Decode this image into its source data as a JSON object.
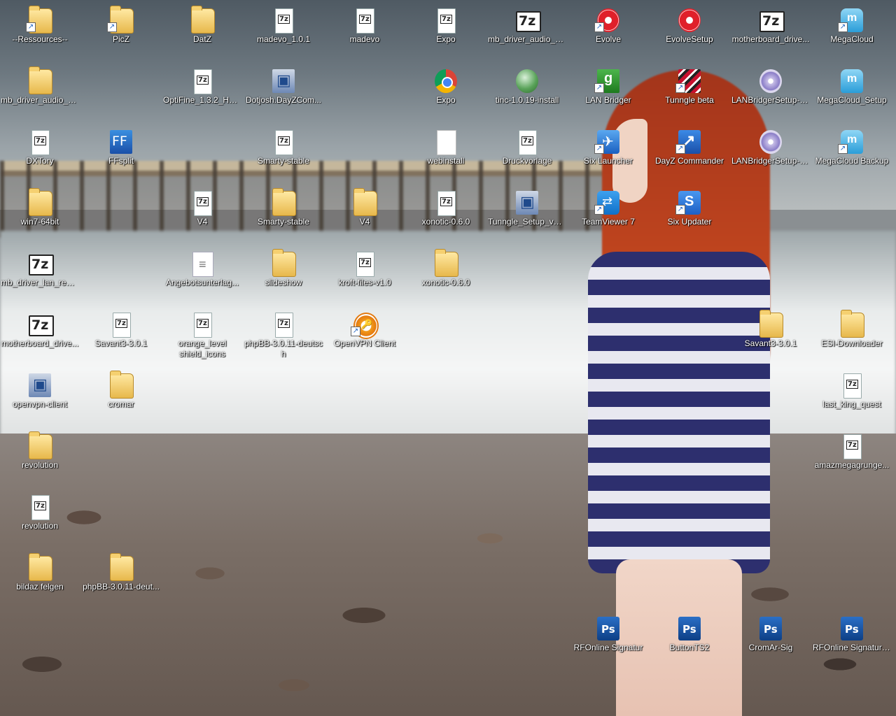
{
  "desktop": {
    "icons": [
      {
        "label": "--Ressources--",
        "icon": "folder-icon",
        "shortcut": true
      },
      {
        "label": "PicZ",
        "icon": "folder-icon",
        "shortcut": true
      },
      {
        "label": "DatZ",
        "icon": "folder-icon",
        "shortcut": false
      },
      {
        "label": "madevo_1.0.1",
        "icon": "archive-7z-icon",
        "shortcut": false
      },
      {
        "label": "madevo",
        "icon": "archive-7z-icon",
        "shortcut": false
      },
      {
        "label": "Expo",
        "icon": "archive-7z-icon",
        "shortcut": false
      },
      {
        "label": "mb_driver_audio_re...",
        "icon": "sevenzip-icon",
        "shortcut": false
      },
      {
        "label": "Evolve",
        "icon": "evolve-icon",
        "shortcut": true
      },
      {
        "label": "EvolveSetup",
        "icon": "evolve-icon",
        "shortcut": false
      },
      {
        "label": "motherboard_drive...",
        "icon": "sevenzip-icon",
        "shortcut": false
      },
      {
        "label": "MegaCloud",
        "icon": "megacloud-icon",
        "shortcut": true
      },
      {
        "label": "mb_driver_audio_re...",
        "icon": "folder-icon",
        "shortcut": false
      },
      {
        "label": "OptiFine_1.3.2_HD...",
        "icon": "archive-7z-icon",
        "shortcut": false
      },
      {
        "label": "Dotjosh.DayZCom...",
        "icon": "installer-icon",
        "shortcut": false
      },
      {
        "label": "Expo",
        "icon": "chrome-icon",
        "shortcut": false
      },
      {
        "label": "tinc-1.0.19-install",
        "icon": "tinc-icon",
        "shortcut": false
      },
      {
        "label": "LAN Bridger",
        "icon": "lanbridger-icon",
        "shortcut": true
      },
      {
        "label": "Tunngle beta",
        "icon": "tunngle-icon",
        "shortcut": true
      },
      {
        "label": "LANBridgerSetup-0...",
        "icon": "disc-setup-icon",
        "shortcut": false
      },
      {
        "label": "MegaCloud_Setup",
        "icon": "megacloud-icon",
        "shortcut": false
      },
      {
        "label": "DXTory",
        "icon": "archive-7z-icon",
        "shortcut": false
      },
      {
        "label": "FFsplit",
        "icon": "ffsplit-icon",
        "shortcut": false
      },
      {
        "label": "Smarty-stable",
        "icon": "archive-7z-icon",
        "shortcut": false
      },
      {
        "label": "webinstall",
        "icon": "file-icon",
        "shortcut": false
      },
      {
        "label": "Druckvorlage",
        "icon": "archive-7z-icon",
        "shortcut": false
      },
      {
        "label": "Six Launcher",
        "icon": "rocket-icon",
        "shortcut": true
      },
      {
        "label": "DayZ Commander",
        "icon": "dayz-commander-icon",
        "shortcut": true
      },
      {
        "label": "LANBridgerSetup-0...",
        "icon": "disc-setup-icon",
        "shortcut": false
      },
      {
        "label": "MegaCloud Backup",
        "icon": "megacloud-icon",
        "shortcut": true
      },
      {
        "label": "win7-64bit",
        "icon": "folder-icon",
        "shortcut": false
      },
      {
        "label": "V4",
        "icon": "archive-7z-icon",
        "shortcut": false
      },
      {
        "label": "Smarty-stable",
        "icon": "folder-icon",
        "shortcut": false
      },
      {
        "label": "V4",
        "icon": "folder-icon",
        "shortcut": false
      },
      {
        "label": "xonotic-0.6.0",
        "icon": "archive-7z-icon",
        "shortcut": false
      },
      {
        "label": "Tunngle_Setup_v4....",
        "icon": "installer-icon",
        "shortcut": false
      },
      {
        "label": "TeamViewer 7",
        "icon": "teamviewer-icon",
        "shortcut": true
      },
      {
        "label": "Six Updater",
        "icon": "six-updater-icon",
        "shortcut": true
      },
      {
        "label": "mb_driver_lan_real...",
        "icon": "sevenzip-icon",
        "shortcut": false
      },
      {
        "label": "Angebotsunterlag...",
        "icon": "document-icon",
        "shortcut": false
      },
      {
        "label": "slideshow",
        "icon": "folder-icon",
        "shortcut": false
      },
      {
        "label": "kroft-files-v1.0",
        "icon": "archive-7z-icon",
        "shortcut": false
      },
      {
        "label": "xonotic-0.6.0",
        "icon": "folder-icon",
        "shortcut": false
      },
      {
        "label": "motherboard_drive...",
        "icon": "sevenzip-icon",
        "shortcut": false
      },
      {
        "label": "Savant3-3.0.1",
        "icon": "archive-7z-icon",
        "shortcut": false
      },
      {
        "label": "orange_level shield_icons",
        "icon": "archive-7z-icon",
        "shortcut": false
      },
      {
        "label": "phpBB-3.0.11-deutsch",
        "icon": "archive-7z-icon",
        "shortcut": false
      },
      {
        "label": "OpenVPN Client",
        "icon": "openvpn-icon",
        "shortcut": true
      },
      {
        "label": "Savant3-3.0.1",
        "icon": "folder-icon",
        "shortcut": false
      },
      {
        "label": "ESI-Downloader",
        "icon": "folder-icon",
        "shortcut": false
      },
      {
        "label": "openvpn-client",
        "icon": "installer-icon",
        "shortcut": false
      },
      {
        "label": "cromar",
        "icon": "folder-icon",
        "shortcut": false
      },
      {
        "label": "last_king_quest",
        "icon": "archive-7z-icon",
        "shortcut": false
      },
      {
        "label": "revolution",
        "icon": "folder-icon",
        "shortcut": false
      },
      {
        "label": "amazmegagrunge...",
        "icon": "archive-7z-icon",
        "shortcut": false
      },
      {
        "label": "revolution",
        "icon": "archive-7z-icon",
        "shortcut": false
      },
      {
        "label": "bildaz felgen",
        "icon": "folder-icon",
        "shortcut": false
      },
      {
        "label": "phpBB-3.0.11-deut...",
        "icon": "folder-icon",
        "shortcut": false
      },
      {
        "label": "RFOnline Signatur",
        "icon": "photoshop-psd-icon",
        "shortcut": false
      },
      {
        "label": "ButtonTS2",
        "icon": "photoshop-psd-icon",
        "shortcut": false
      },
      {
        "label": "CromAr-Sig",
        "icon": "photoshop-psd-icon",
        "shortcut": false
      },
      {
        "label": "RFOnline Signaturug",
        "icon": "photoshop-psd-icon",
        "shortcut": false
      }
    ]
  }
}
